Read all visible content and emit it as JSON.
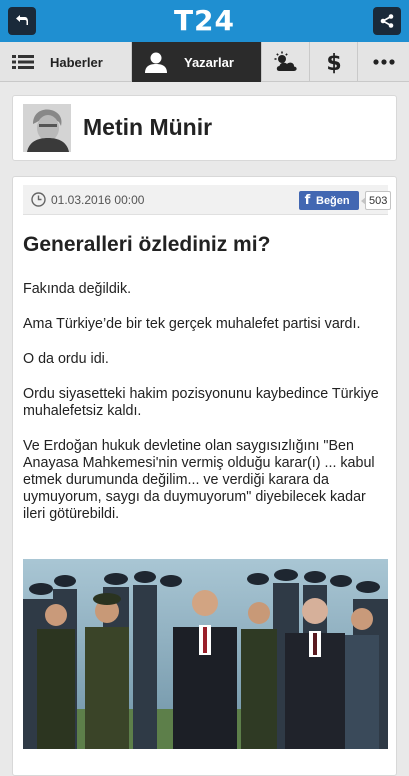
{
  "header": {
    "logo": "T24",
    "back_icon": "back-arrow-icon",
    "share_icon": "share-icon",
    "bg_color": "#1f8fd1"
  },
  "nav": {
    "items": [
      {
        "label": "Haberler",
        "icon": "list-icon"
      },
      {
        "label": "Yazarlar",
        "icon": "person-icon",
        "active": true
      },
      {
        "label": "",
        "icon": "weather-icon"
      },
      {
        "label": "",
        "icon": "dollar-icon"
      },
      {
        "label": "",
        "icon": "more-icon"
      }
    ]
  },
  "author": {
    "name": "Metin Münir"
  },
  "article": {
    "date": "01.03.2016 00:00",
    "like_label": "Beğen",
    "like_count": "503",
    "title": "Generalleri özlediniz mi?",
    "paragraphs": [
      "Fakında değildik.",
      "Ama Türkiye’de bir tek gerçek muhalefet partisi vardı.",
      "O da ordu idi.",
      "Ordu siyasetteki hakim pozisyonunu kaybedince Türkiye muhalefetsiz kaldı.",
      "Ve Erdoğan hukuk devletine olan saygısızlığını \"Ben Anayasa Mahkemesi'nin vermiş olduğu karar(ı) ... kabul etmek durumunda değilim... ve verdiği karara da uymuyorum, saygı da duymuyorum\" diyebilecek kadar ileri götürebildi."
    ]
  }
}
